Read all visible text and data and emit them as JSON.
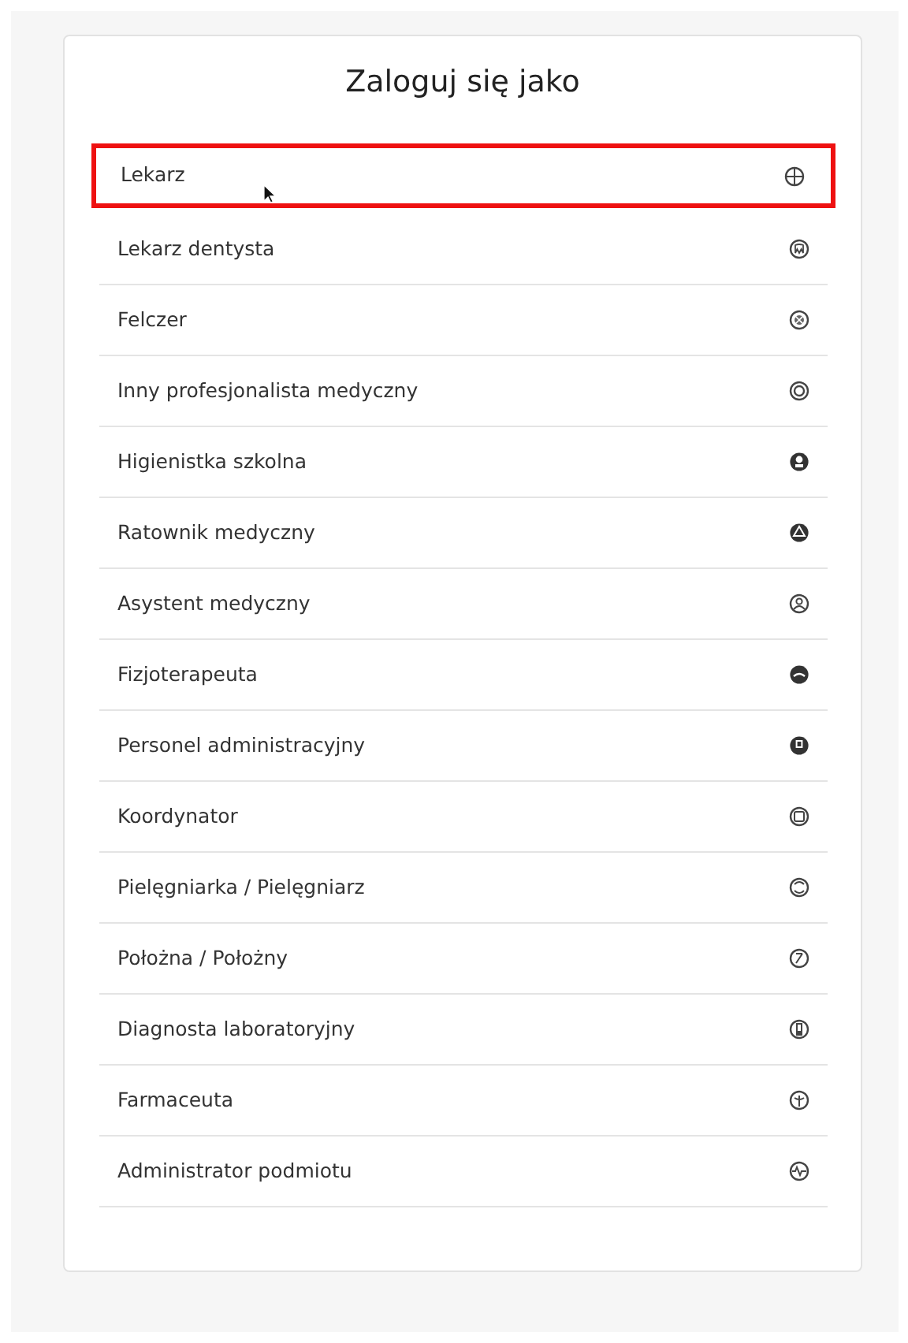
{
  "title": "Zaloguj się jako",
  "roles": [
    {
      "label": "Lekarz",
      "selected": true
    },
    {
      "label": "Lekarz dentysta",
      "selected": false
    },
    {
      "label": "Felczer",
      "selected": false
    },
    {
      "label": "Inny profesjonalista medyczny",
      "selected": false
    },
    {
      "label": "Higienistka szkolna",
      "selected": false
    },
    {
      "label": "Ratownik medyczny",
      "selected": false
    },
    {
      "label": "Asystent medyczny",
      "selected": false
    },
    {
      "label": "Fizjoterapeuta",
      "selected": false
    },
    {
      "label": "Personel administracyjny",
      "selected": false
    },
    {
      "label": "Koordynator",
      "selected": false
    },
    {
      "label": "Pielęgniarka / Pielęgniarz",
      "selected": false
    },
    {
      "label": "Położna / Położny",
      "selected": false
    },
    {
      "label": "Diagnosta laboratoryjny",
      "selected": false
    },
    {
      "label": "Farmaceuta",
      "selected": false
    },
    {
      "label": "Administrator podmiotu",
      "selected": false
    }
  ]
}
